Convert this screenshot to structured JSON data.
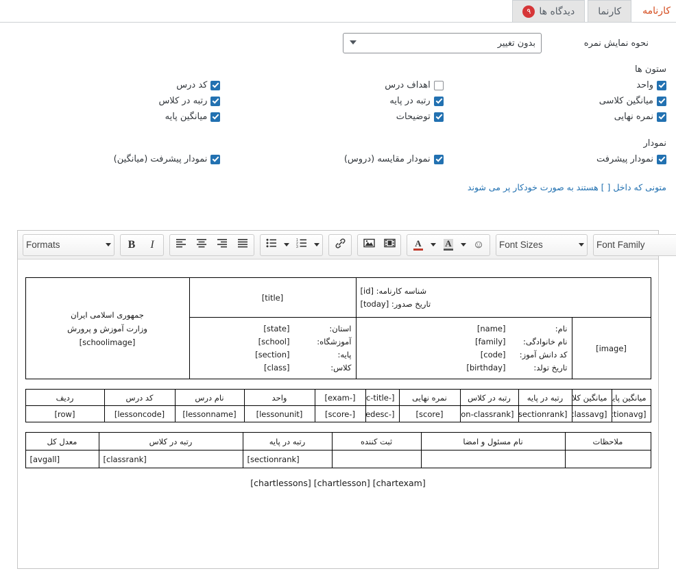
{
  "tabs": [
    {
      "label": "کارنامه",
      "active": true,
      "badge": null
    },
    {
      "label": "کارنما",
      "active": false,
      "badge": null
    },
    {
      "label": "دیدگاه ها",
      "active": false,
      "badge": "۹"
    }
  ],
  "settings": {
    "score_display": {
      "label": "نحوه نمایش نمره",
      "value": "بدون تغییر",
      "options": [
        "بدون تغییر"
      ]
    },
    "columns_title": "ستون ها",
    "columns": {
      "col_right": [
        {
          "label": "کد درس",
          "checked": true
        },
        {
          "label": "رتبه در کلاس",
          "checked": true
        },
        {
          "label": "میانگین پایه",
          "checked": true
        }
      ],
      "col_mid": [
        {
          "label": "اهداف درس",
          "checked": false
        },
        {
          "label": "رتبه در پایه",
          "checked": true
        },
        {
          "label": "توضیحات",
          "checked": true
        }
      ],
      "col_left": [
        {
          "label": "واحد",
          "checked": true
        },
        {
          "label": "میانگین کلاسی",
          "checked": true
        },
        {
          "label": "نمره نهایی",
          "checked": true
        }
      ]
    },
    "chart_title": "نمودار",
    "charts": {
      "col_right": [
        {
          "label": "نمودار پیشرفت (میانگین)",
          "checked": true
        }
      ],
      "col_mid": [
        {
          "label": "نمودار مقایسه (دروس)",
          "checked": true
        }
      ],
      "col_left": [
        {
          "label": "نمودار پیشرفت",
          "checked": true
        }
      ]
    },
    "hint": "متونی که داخل [ ] هستند به صورت خودکار پر می شوند"
  },
  "editor": {
    "toolbar": {
      "formats": "Formats",
      "bold": "B",
      "italic": "I",
      "align_left": "align-left",
      "align_center": "align-center",
      "align_right": "align-right",
      "align_justify": "align-justify",
      "bullist": "bullet-list",
      "numlist": "numbered-list",
      "link": "link",
      "image": "image",
      "media": "media",
      "forecolor": "A",
      "backcolor": "A",
      "emoticons": "☺",
      "font_sizes": "Font Sizes",
      "font_family": "Font Family"
    }
  },
  "document": {
    "header_table": {
      "org_lines": [
        "جمهوری اسلامی ایران",
        "وزارت آموزش و پرورش",
        "[schoolimage]"
      ],
      "title_token": "[title]",
      "id_rows": [
        {
          "key": "شناسه کارنامه:",
          "value": "[id]"
        },
        {
          "key": "تاریخ صدور:",
          "value": "[today]"
        }
      ],
      "school_rows": [
        {
          "key": "استان:",
          "value": "[state]"
        },
        {
          "key": "آموزشگاه:",
          "value": "[school]"
        },
        {
          "key": "پایه:",
          "value": "[section]"
        },
        {
          "key": "کلاس:",
          "value": "[class]"
        }
      ],
      "student_rows": [
        {
          "key": "نام:",
          "value": "[name]"
        },
        {
          "key": "نام خانوادگی:",
          "value": "[family]"
        },
        {
          "key": "کد دانش آموز:",
          "value": "[code]"
        },
        {
          "key": "تاریخ تولد:",
          "value": "[birthday]"
        }
      ],
      "image_token": "[image]"
    },
    "grades_table": {
      "headers": [
        "ردیف",
        "کد درس",
        "نام درس",
        "واحد",
        "[-exam]",
        "[-scoredesc-title]",
        "نمره نهایی",
        "رتبه در کلاس",
        "رتبه در پایه",
        "میانگین کلاسی",
        "میانگین پایه"
      ],
      "values": [
        "[row]",
        "[lessoncode]",
        "[lessonname]",
        "[lessonunit]",
        "[-score]",
        "[-scoredesc]",
        "[score]",
        "[lesson-classrank]",
        "[lesson-sectionrank]",
        "[lesson-classavg]",
        "[lesson-sectionavg]"
      ]
    },
    "summary_table": {
      "headers": [
        "معدل کل",
        "رتبه در کلاس",
        "رتبه در پایه",
        "ثبت کننده",
        "نام مسئول و امضا",
        "ملاحظات"
      ],
      "values": [
        "[avgall]",
        "[classrank]",
        "[sectionrank]",
        "",
        "",
        ""
      ]
    },
    "chart_tokens": "[chartlessons] [chartlesson] [chartexam]"
  },
  "colors": {
    "accent_red": "#d54e21",
    "badge_red": "#d63638",
    "checkbox_blue": "#2271b1",
    "link_blue": "#2271b1"
  }
}
